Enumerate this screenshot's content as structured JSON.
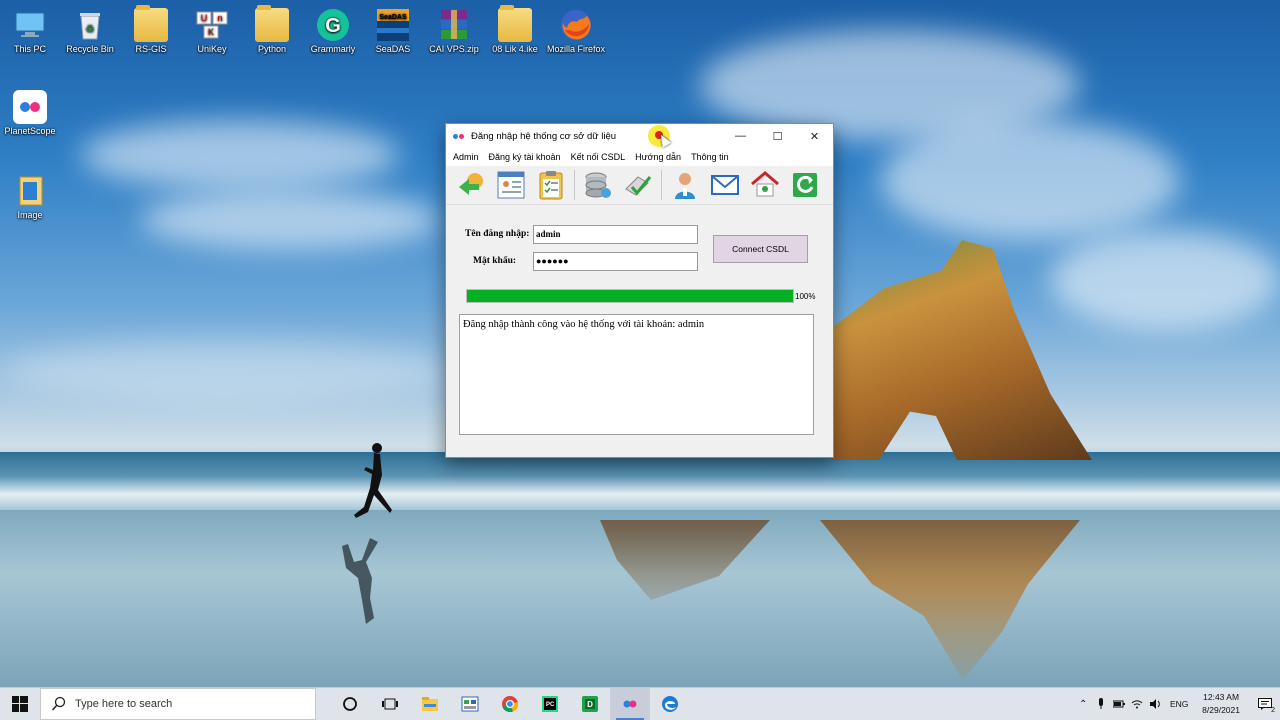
{
  "desktop": {
    "icons": [
      {
        "label": "This PC",
        "icon": "this-pc-icon"
      },
      {
        "label": "Recycle Bin",
        "icon": "recycle-bin-icon"
      },
      {
        "label": "RS-GIS",
        "icon": "folder-icon"
      },
      {
        "label": "UniKey",
        "icon": "unikey-icon"
      },
      {
        "label": "Python",
        "icon": "folder-icon"
      },
      {
        "label": "Grammarly",
        "icon": "grammarly-icon"
      },
      {
        "label": "SeaDAS",
        "icon": "seadas-icon"
      },
      {
        "label": "CAI VPS.zip",
        "icon": "winrar-icon"
      },
      {
        "label": "08 Lik 4.ike",
        "icon": "folder-icon"
      },
      {
        "label": "Mozilla Firefox",
        "icon": "firefox-icon"
      },
      {
        "label": "PlanetScope",
        "icon": "planetscope-icon"
      },
      {
        "label": "Image",
        "icon": "folder-icon"
      }
    ]
  },
  "window": {
    "title": "Đăng nhập hệ thống cơ sở dữ liệu",
    "controls": {
      "minimize": "—",
      "maximize": "☐",
      "close": "✕"
    },
    "menu": [
      "Admin",
      "Đăng ký tài khoản",
      "Kết nối CSDL",
      "Hướng dẫn",
      "Thông tin"
    ],
    "toolbar": [
      {
        "icon": "connect-refresh-icon"
      },
      {
        "icon": "user-form-icon"
      },
      {
        "icon": "clipboard-icon"
      },
      {
        "icon": "database-icon"
      },
      {
        "icon": "checkmark-icon"
      },
      {
        "icon": "user-icon"
      },
      {
        "icon": "mail-icon"
      },
      {
        "icon": "home-icon"
      },
      {
        "icon": "exit-icon"
      }
    ],
    "form": {
      "username_label": "Tên đăng nhập:",
      "username_value": "admin",
      "password_label": "Mật khẩu:",
      "password_value": "●●●●●●",
      "connect_label": "Connect CSDL",
      "progress_percent": 100,
      "progress_label": "100%",
      "log_text": "Đăng nhập thành công vào hệ thống với tài khoản: admin"
    }
  },
  "taskbar": {
    "search_placeholder": "Type here to search",
    "apps": [
      {
        "icon": "cortana-icon"
      },
      {
        "icon": "task-view-icon"
      },
      {
        "icon": "file-explorer-icon"
      },
      {
        "icon": "windows-app-icon"
      },
      {
        "icon": "chrome-icon"
      },
      {
        "icon": "pycharm-icon"
      },
      {
        "icon": "green-app-icon"
      },
      {
        "icon": "planetscope-icon"
      },
      {
        "icon": "edge-icon"
      }
    ],
    "tray": {
      "language": "ENG",
      "time": "12:43 AM",
      "date": "8/29/2021",
      "notification_count": "2"
    }
  }
}
